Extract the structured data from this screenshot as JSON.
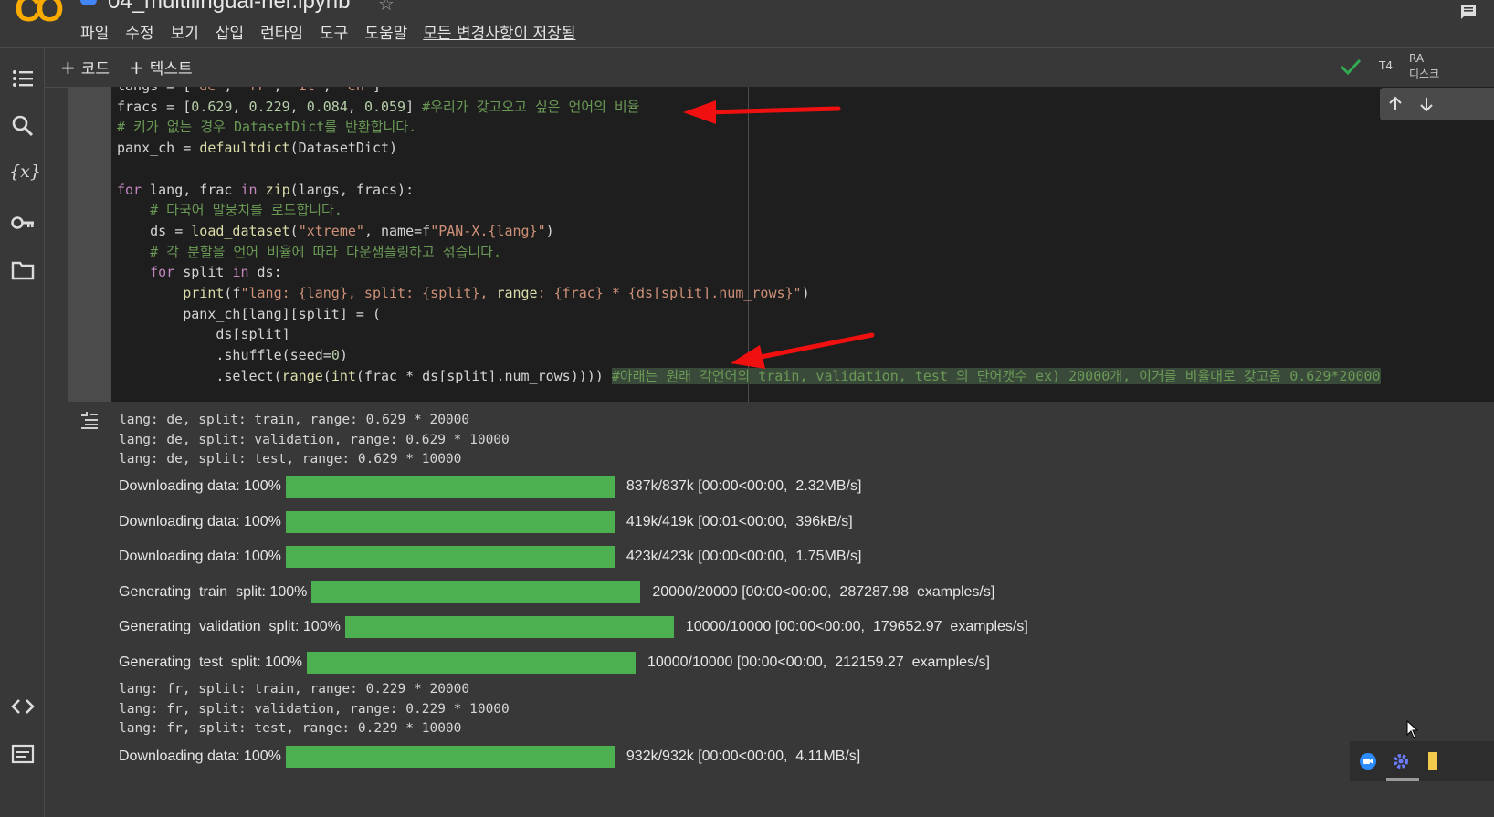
{
  "header": {
    "logo": "CO",
    "notebook_title": "04_multilingual-ner.ipynb",
    "menu": [
      "파일",
      "수정",
      "보기",
      "삽입",
      "런타임",
      "도구",
      "도움말"
    ],
    "saved_status": "모든 변경사항이 저장됨"
  },
  "toolbar": {
    "add_code": "코드",
    "add_text": "텍스트",
    "runtime_type": "T4",
    "ram_label": "RA",
    "disk_label": "디스크"
  },
  "sidebar": {
    "items": [
      "toc-icon",
      "search-icon",
      "variables-icon",
      "secrets-key-icon",
      "files-folder-icon",
      "code-snippets-icon",
      "terminal-icon"
    ],
    "variables_glyph": "{x}"
  },
  "code_cell": {
    "lines": [
      "langs = [\"de\", \"fr\", \"it\", \"en\"]",
      "fracs = [0.629, 0.229, 0.084, 0.059] #우리가 갖고오고 싶은 언어의 비율",
      "# 키가 없는 경우 DatasetDict를 반환합니다.",
      "panx_ch = defaultdict(DatasetDict)",
      "",
      "for lang, frac in zip(langs, fracs):",
      "    # 다국어 말뭉치를 로드합니다.",
      "    ds = load_dataset(\"xtreme\", name=f\"PAN-X.{lang}\")",
      "    # 각 분할을 언어 비율에 따라 다운샘플링하고 섞습니다.",
      "    for split in ds:",
      "        print(f\"lang: {lang}, split: {split}, range: {frac} * {ds[split].num_rows}\")",
      "        panx_ch[lang][split] = (",
      "            ds[split]",
      "            .shuffle(seed=0)",
      "            .select(range(int(frac * ds[split].num_rows)))) ",
      "#아래는 원래 각언어의 train, validation, test 의 단어갯수 ex) 20000개, 이거를 비율대로 갖고옴 0.629*20000"
    ]
  },
  "output": {
    "text_blocks": [
      [
        "lang: de, split: train, range: 0.629 * 20000",
        "lang: de, split: validation, range: 0.629 * 10000",
        "lang: de, split: test, range: 0.629 * 10000"
      ],
      [
        "lang: fr, split: train, range: 0.229 * 20000",
        "lang: fr, split: validation, range: 0.229 * 10000",
        "lang: fr, split: test, range: 0.229 * 10000"
      ]
    ],
    "progress": [
      {
        "label": "Downloading data: 100%",
        "progress": 1.0,
        "info": "837k/837k [00:00<00:00,  2.32MB/s]"
      },
      {
        "label": "Downloading data: 100%",
        "progress": 1.0,
        "info": "419k/419k [00:01<00:00,  396kB/s]"
      },
      {
        "label": "Downloading data: 100%",
        "progress": 1.0,
        "info": "423k/423k [00:00<00:00,  1.75MB/s]"
      },
      {
        "label": "Generating  train  split: 100%",
        "progress": 1.0,
        "info": "20000/20000 [00:00<00:00,  287287.98  examples/s]"
      },
      {
        "label": "Generating  validation  split: 100%",
        "progress": 1.0,
        "info": "10000/10000 [00:00<00:00,  179652.97  examples/s]"
      },
      {
        "label": "Generating  test  split: 100%",
        "progress": 1.0,
        "info": "10000/10000 [00:00<00:00,  212159.27  examples/s]"
      },
      {
        "label": "Downloading data: 100%",
        "progress": 1.0,
        "info": "932k/932k [00:00<00:00,  4.11MB/s]"
      }
    ]
  },
  "colors": {
    "progress_fill": "#4caf50",
    "annotation_arrow": "#ff0000",
    "logo": "#f9ab00"
  }
}
